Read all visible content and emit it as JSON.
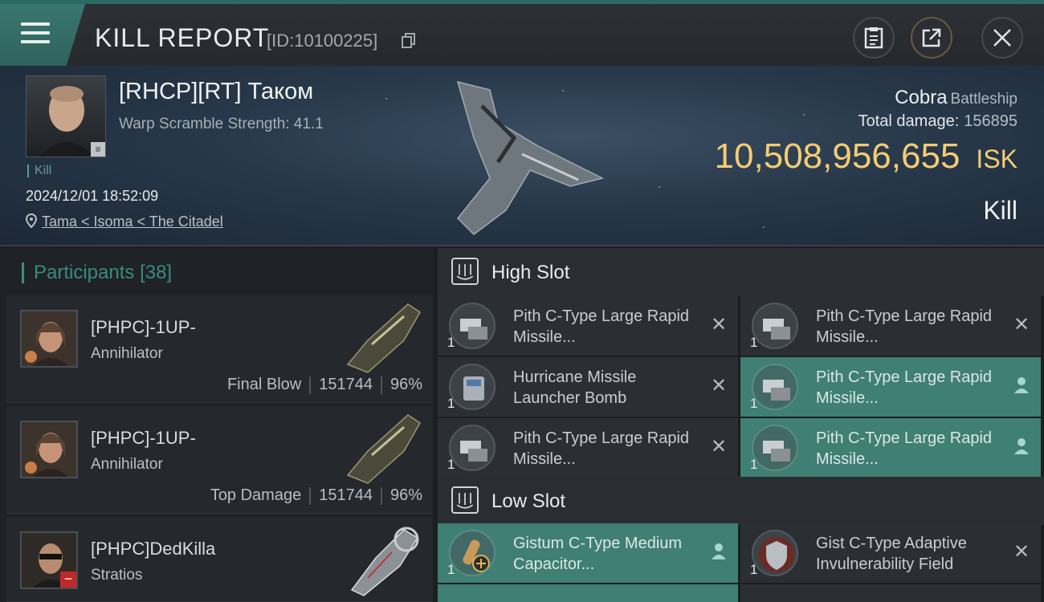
{
  "header": {
    "title": "KILL REPORT",
    "report_id": "[ID:10100225]",
    "icons": [
      "menu-icon",
      "copy-icon",
      "clipboard-icon",
      "share-icon",
      "close-icon"
    ]
  },
  "victim": {
    "name": "[RHCP][RT] Таком",
    "scramble": "Warp Scramble Strength: 41.1",
    "kill_tag": "Kill",
    "datetime": "2024/12/01 18:52:09",
    "location": "Tama < Isoma < The Citadel",
    "ship_name": "Cobra",
    "ship_class": "Battleship",
    "damage_label": "Total damage:",
    "damage_value": "156895",
    "isk_value": "10,508,956,655",
    "isk_unit": "ISK",
    "kill_label": "Kill"
  },
  "participants": {
    "title": "Participants",
    "count": "[38]",
    "items": [
      {
        "name": "[PHPC]-1UP-",
        "ship": "Annihilator",
        "tag": "Final Blow",
        "damage": "151744",
        "percent": "96%"
      },
      {
        "name": "[PHPC]-1UP-",
        "ship": "Annihilator",
        "tag": "Top Damage",
        "damage": "151744",
        "percent": "96%"
      },
      {
        "name": "[PHPC]DedKilla",
        "ship": "Stratios",
        "tag": "",
        "damage": "",
        "percent": ""
      }
    ]
  },
  "high_slot": {
    "title": "High Slot",
    "modules": [
      {
        "qty": "1",
        "name": "Pith C-Type Large Rapid Missile...",
        "status": "destroyed"
      },
      {
        "qty": "1",
        "name": "Pith C-Type Large Rapid Missile...",
        "status": "destroyed"
      },
      {
        "qty": "1",
        "name": "Hurricane Missile Launcher Bomb",
        "status": "destroyed"
      },
      {
        "qty": "1",
        "name": "Pith C-Type Large Rapid Missile...",
        "status": "dropped"
      },
      {
        "qty": "1",
        "name": "Pith C-Type Large Rapid Missile...",
        "status": "destroyed"
      },
      {
        "qty": "1",
        "name": "Pith C-Type Large Rapid Missile...",
        "status": "dropped"
      }
    ]
  },
  "low_slot": {
    "title": "Low Slot",
    "modules": [
      {
        "qty": "1",
        "name": "Gistum C-Type Medium Capacitor...",
        "status": "dropped"
      },
      {
        "qty": "1",
        "name": "Gist C-Type Adaptive Invulnerability Field",
        "status": "destroyed"
      }
    ]
  },
  "colors": {
    "accent_teal": "#3f7f74",
    "isk_gold": "#f4cc72",
    "participants_accent": "#3a8c80"
  }
}
